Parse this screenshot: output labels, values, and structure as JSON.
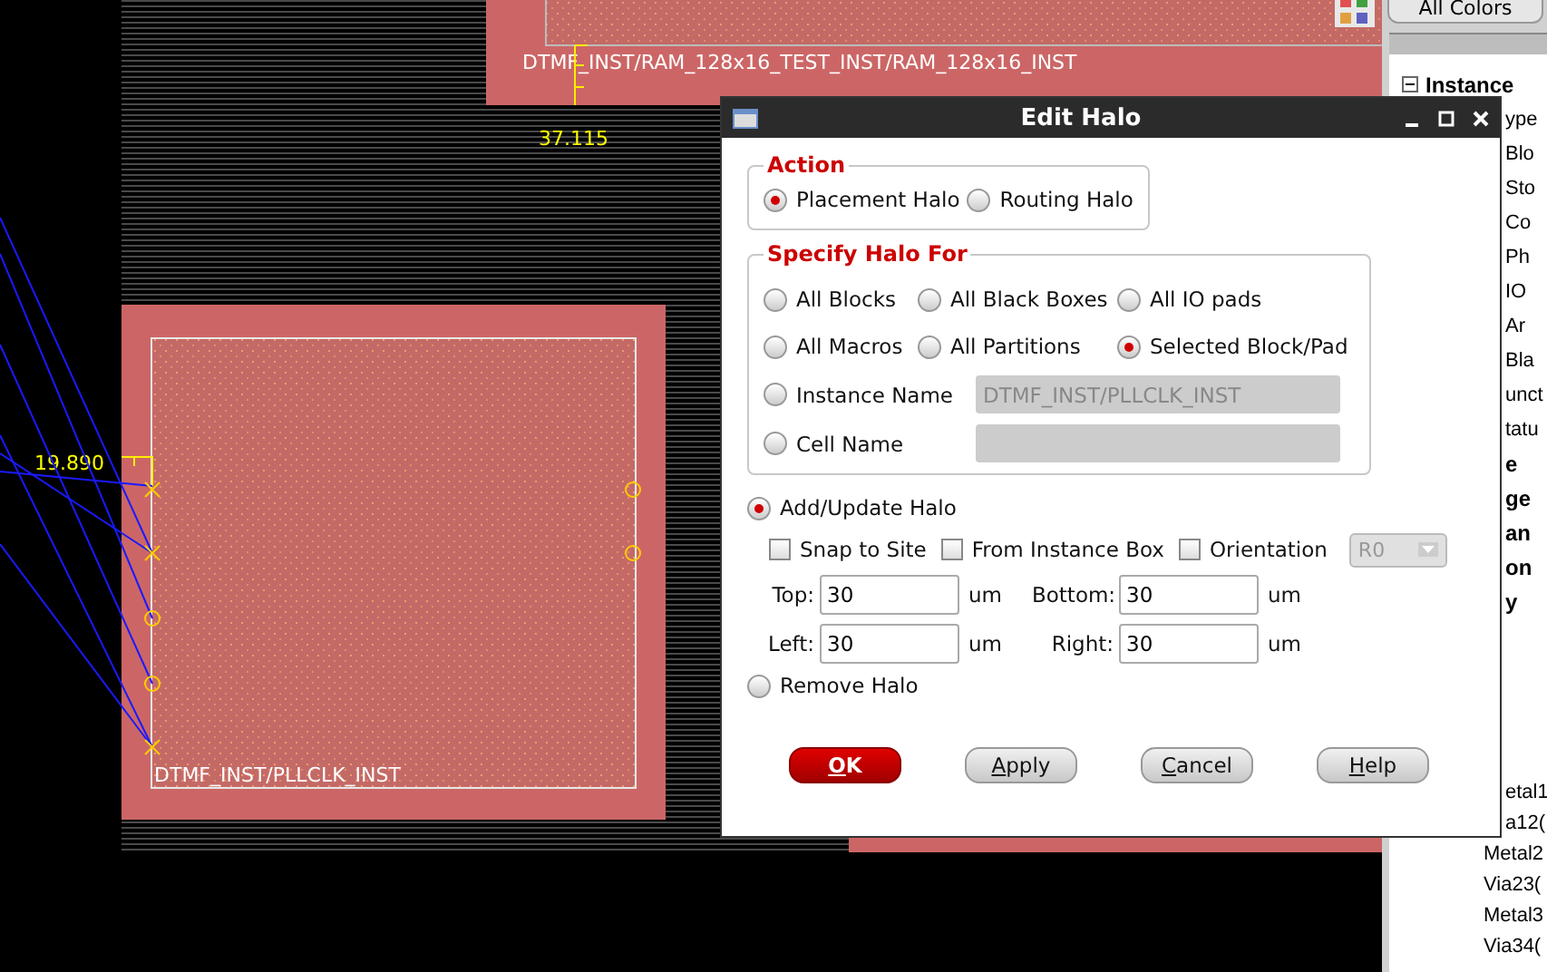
{
  "canvas": {
    "blocks": [
      {
        "label": "DTMF_INST/RAM_128x16_TEST_INST/RAM_128x16_INST",
        "kind": "top"
      },
      {
        "label": "DTMF_INST/PLLCLK_INST",
        "kind": "main"
      }
    ],
    "measurements": [
      "37.115",
      "19.890"
    ]
  },
  "side_panel": {
    "all_colors_button": "All Colors",
    "tree": [
      {
        "label": "Instance",
        "bold": true,
        "expanded": true,
        "children": [
          {
            "label": "ype",
            "bold": false,
            "children": [
              {
                "label": "Blo",
                "bold": false
              },
              {
                "label": "Sto",
                "bold": false
              },
              {
                "label": "Co",
                "bold": false
              },
              {
                "label": "Ph",
                "bold": false
              },
              {
                "label": "IO",
                "bold": false
              },
              {
                "label": "Ar",
                "bold": false
              },
              {
                "label": "Bla",
                "bold": false
              }
            ]
          },
          {
            "label": "unct",
            "bold": false
          },
          {
            "label": "tatu",
            "bold": false
          },
          {
            "label": "e",
            "bold": true
          },
          {
            "label": "ge",
            "bold": true
          },
          {
            "label": "an",
            "bold": true
          },
          {
            "label": "on",
            "bold": true
          },
          {
            "label": "y",
            "bold": true
          }
        ]
      }
    ],
    "layer_items": [
      {
        "label": "etal1"
      },
      {
        "label": "a12("
      },
      {
        "label": "Metal2"
      },
      {
        "label": "Via23("
      },
      {
        "label": "Metal3"
      },
      {
        "label": "Via34("
      }
    ]
  },
  "dialog": {
    "title": "Edit Halo",
    "action": {
      "title": "Action",
      "options": [
        {
          "label": "Placement Halo",
          "selected": true
        },
        {
          "label": "Routing Halo",
          "selected": false
        }
      ]
    },
    "specify": {
      "title": "Specify Halo For",
      "options": [
        {
          "label": "All Blocks",
          "selected": false
        },
        {
          "label": "All Black Boxes",
          "selected": false
        },
        {
          "label": "All IO pads",
          "selected": false
        },
        {
          "label": "All Macros",
          "selected": false
        },
        {
          "label": "All Partitions",
          "selected": false
        },
        {
          "label": "Selected Block/Pad",
          "selected": true
        }
      ],
      "name_options": [
        {
          "label": "Instance Name",
          "selected": false,
          "value": "DTMF_INST/PLLCLK_INST"
        },
        {
          "label": "Cell Name",
          "selected": false
        }
      ]
    },
    "add_update": {
      "label": "Add/Update Halo",
      "selected": true
    },
    "checkboxes": [
      {
        "label": "Snap to Site",
        "checked": false
      },
      {
        "label": "From Instance Box",
        "checked": false
      },
      {
        "label": "Orientation",
        "checked": false
      }
    ],
    "orientation_select": {
      "value": "R0",
      "disabled": true
    },
    "fields": [
      {
        "label": "Top:",
        "value": "30",
        "unit": "um"
      },
      {
        "label": "Bottom:",
        "value": "30",
        "unit": "um"
      },
      {
        "label": "Left:",
        "value": "30",
        "unit": "um"
      },
      {
        "label": "Right:",
        "value": "30",
        "unit": "um"
      }
    ],
    "remove": {
      "label": "Remove Halo",
      "selected": false
    },
    "buttons": [
      {
        "label": "OK",
        "kind": "primary"
      },
      {
        "label": "Apply",
        "kind": "normal"
      },
      {
        "label": "Cancel",
        "kind": "normal"
      },
      {
        "label": "Help",
        "kind": "normal"
      }
    ]
  }
}
